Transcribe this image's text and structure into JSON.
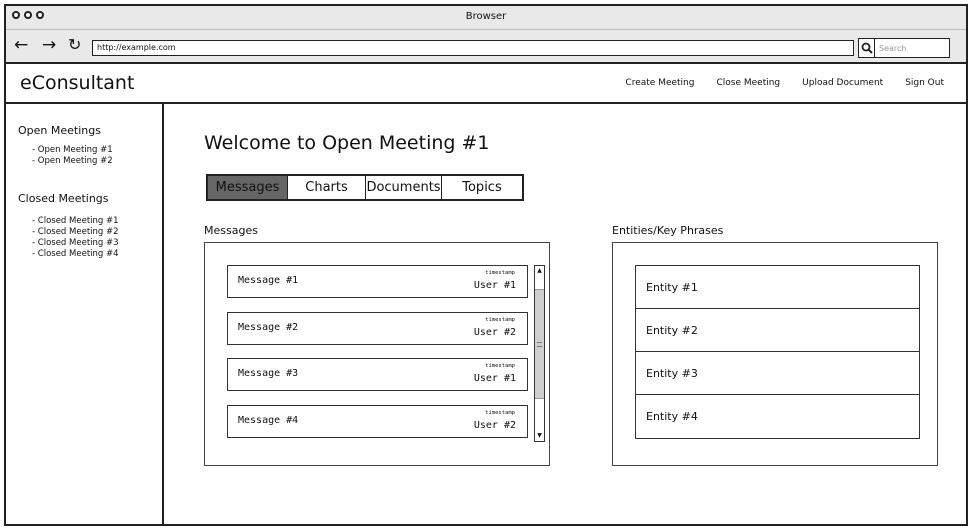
{
  "window": {
    "title": "Browser"
  },
  "navbar": {
    "back_glyph": "←",
    "forward_glyph": "→",
    "reload_glyph": "↻",
    "url": "http://example.com",
    "search_placeholder": "Search"
  },
  "app": {
    "brand": "eConsultant",
    "links": [
      "Create Meeting",
      "Close Meeting",
      "Upload Document",
      "Sign Out"
    ]
  },
  "sidebar": {
    "open_heading": "Open Meetings",
    "open_items": [
      "- Open Meeting #1",
      "- Open Meeting #2"
    ],
    "closed_heading": "Closed Meetings",
    "closed_items": [
      "- Closed Meeting #1",
      "- Closed Meeting #2",
      "- Closed Meeting #3",
      "- Closed Meeting #4"
    ]
  },
  "main": {
    "title": "Welcome to Open Meeting #1",
    "tabs": [
      {
        "label": "Messages",
        "active": true
      },
      {
        "label": "Charts",
        "active": false
      },
      {
        "label": "Documents",
        "active": false
      },
      {
        "label": "Topics",
        "active": false
      }
    ],
    "messages_label": "Messages",
    "messages": [
      {
        "text": "Message #1",
        "timestamp": "timestamp",
        "user": "User #1"
      },
      {
        "text": "Message #2",
        "timestamp": "timestamp",
        "user": "User #2"
      },
      {
        "text": "Message #3",
        "timestamp": "timestamp",
        "user": "User #1"
      },
      {
        "text": "Message #4",
        "timestamp": "timestamp",
        "user": "User #2"
      }
    ],
    "entities_label": "Entities/Key Phrases",
    "entities": [
      "Entity #1",
      "Entity #2",
      "Entity #3",
      "Entity #4"
    ]
  },
  "colors": {
    "active_tab": "#666666",
    "chrome": "#e9e9e9"
  }
}
